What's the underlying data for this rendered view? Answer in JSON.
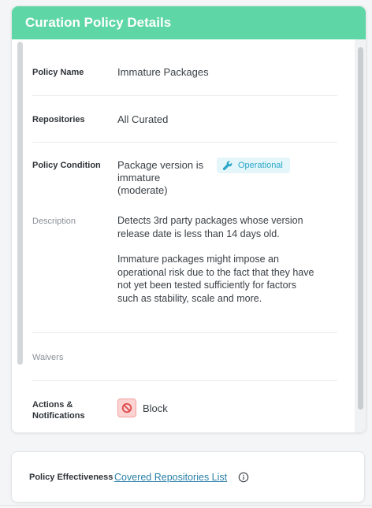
{
  "panel": {
    "title": "Curation Policy Details",
    "rows": {
      "policy_name": {
        "label": "Policy Name",
        "value": "Immature Packages"
      },
      "repositories": {
        "label": "Repositories",
        "value": "All Curated"
      },
      "policy_condition": {
        "label": "Policy Condition",
        "value": "Package version is immature (moderate)",
        "badge": {
          "label": "Operational",
          "icon": "wrench-icon",
          "color": "#2aa6c7"
        }
      },
      "description": {
        "label": "Description",
        "paragraph1_prefix": "Detects 3rd party packages whose version release date is less than ",
        "paragraph1_days": "14",
        "paragraph1_suffix": " days old.",
        "paragraph2": "Immature packages might impose an operational risk due to the fact that they have not yet been tested sufficiently for factors such as stability, scale and more."
      },
      "waivers": {
        "label": "Waivers"
      },
      "actions": {
        "label": "Actions & Notifications",
        "action_label": "Block",
        "action_icon": "block-icon"
      }
    },
    "header_color": "#5fd6a6"
  },
  "effectiveness": {
    "label": "Policy Effectiveness",
    "link": "Covered Repositories List",
    "info_icon": "info-icon"
  }
}
